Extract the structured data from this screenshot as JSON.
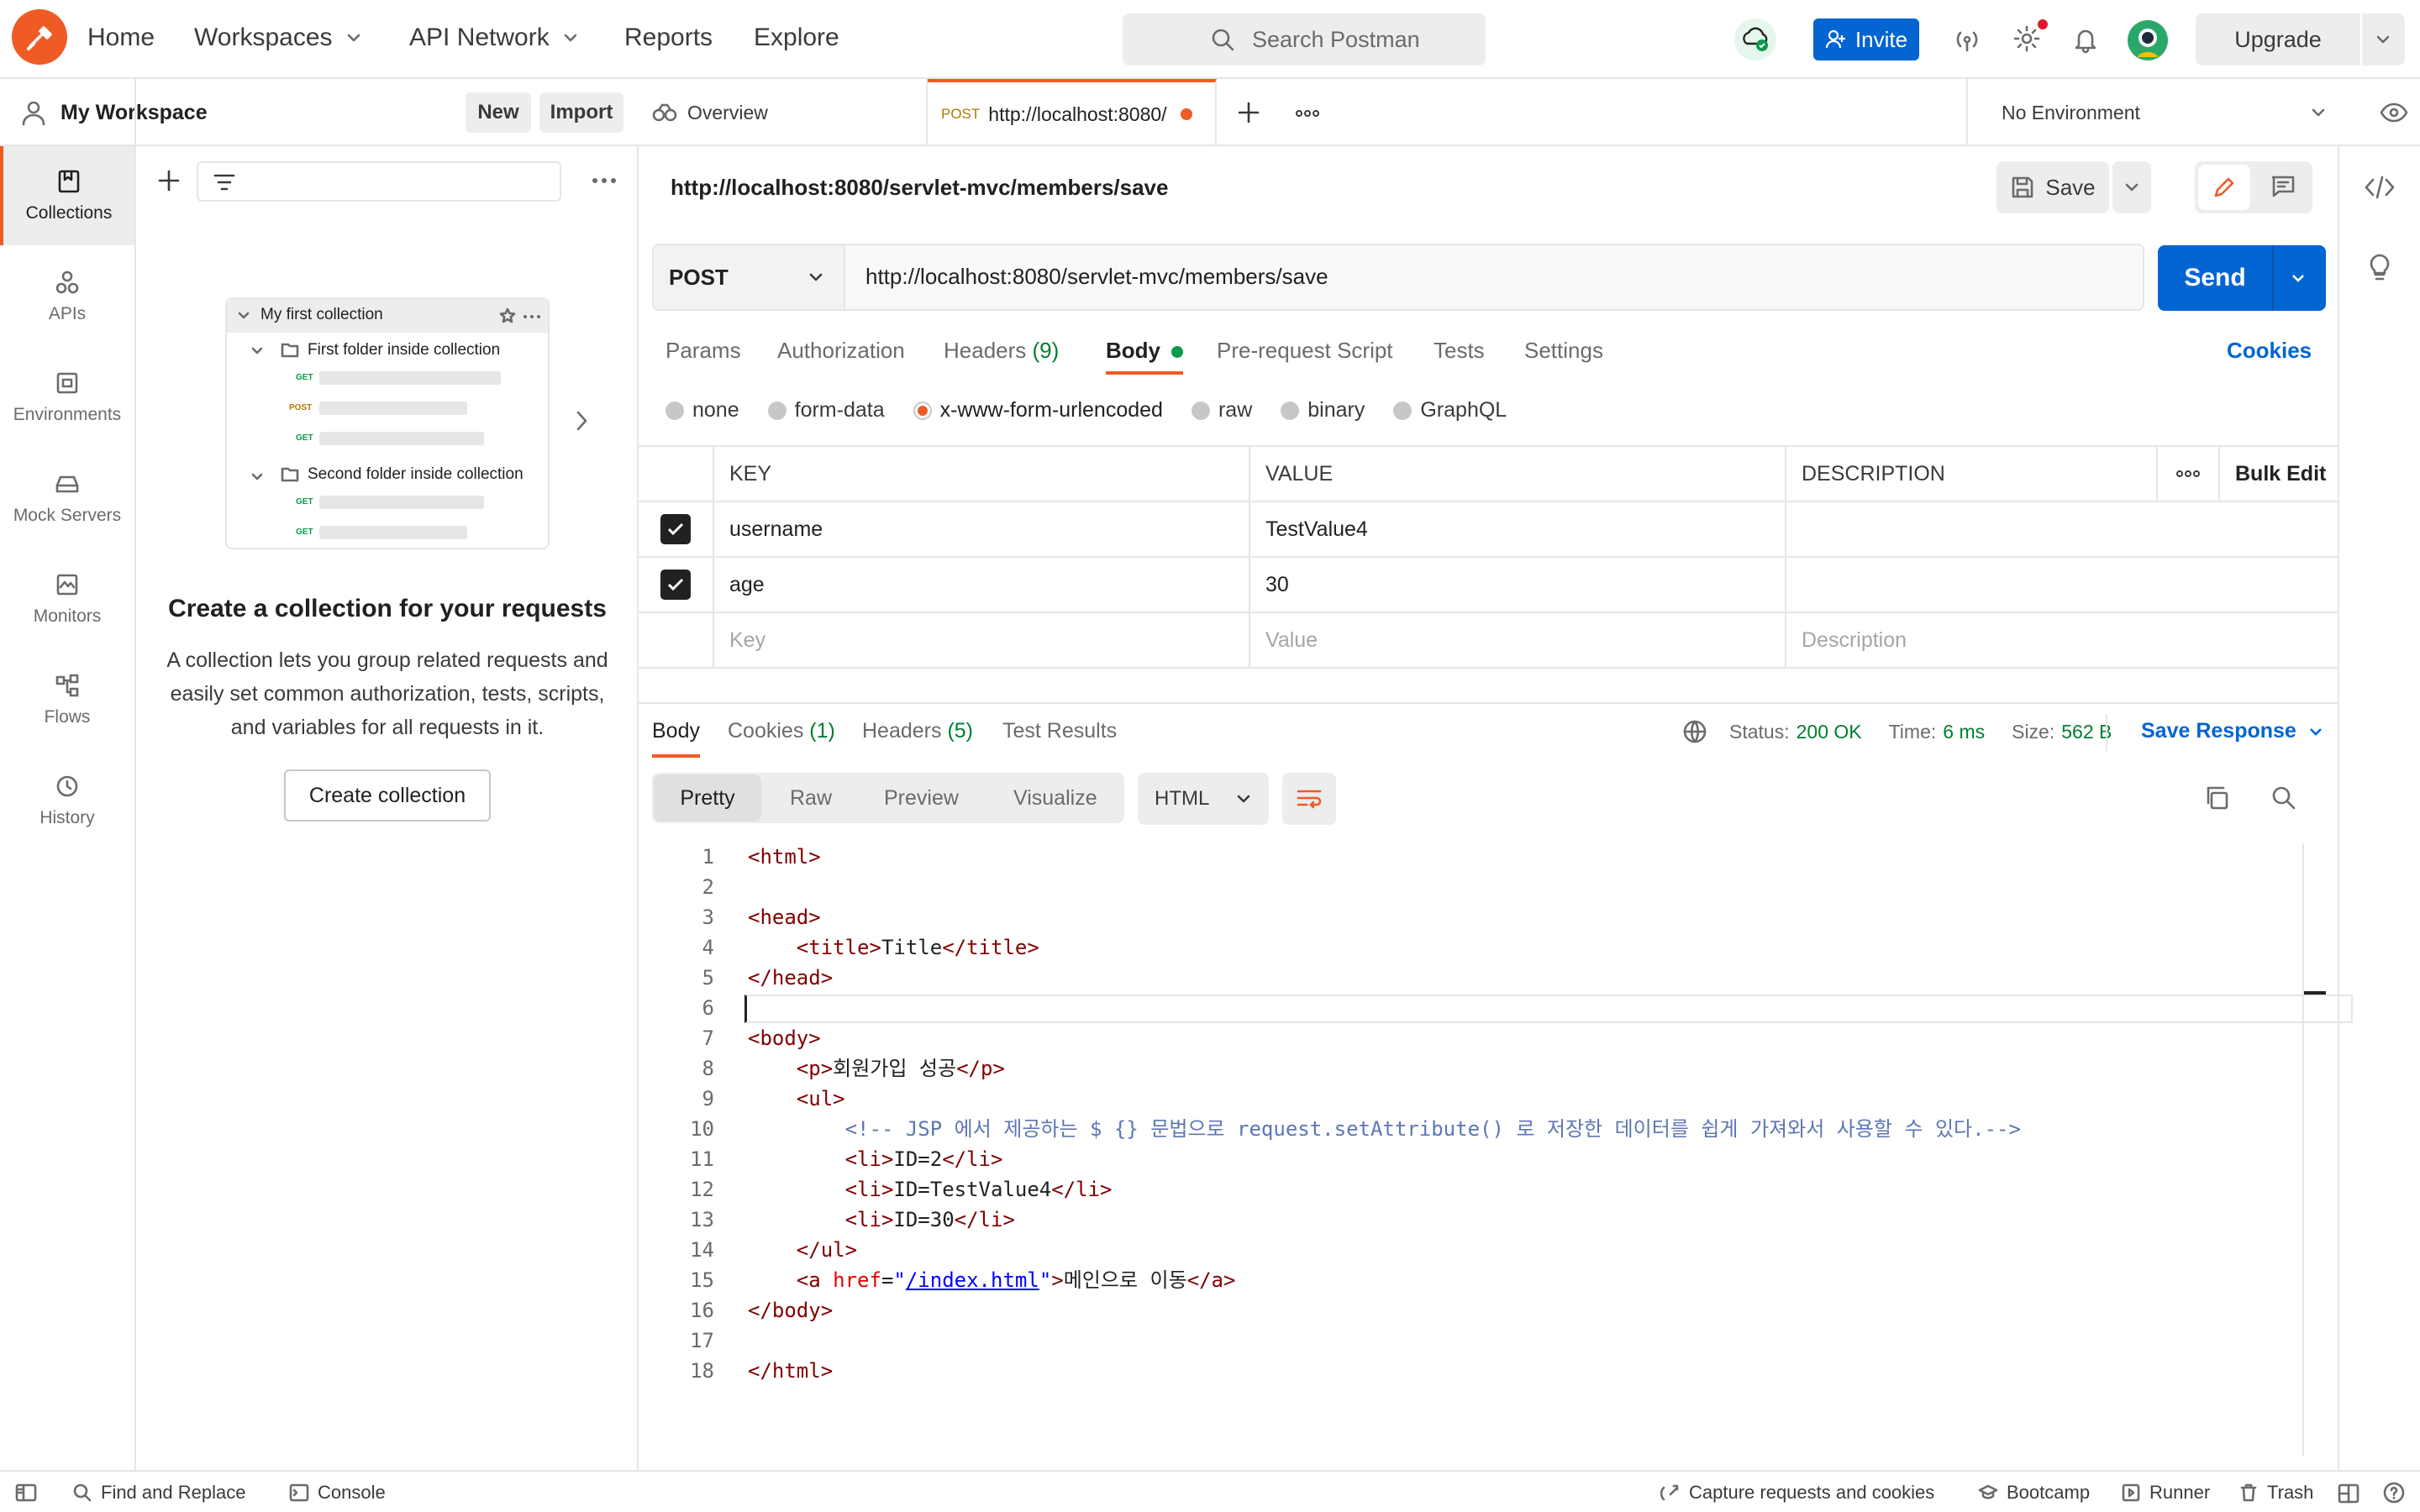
{
  "header": {
    "nav": [
      "Home",
      "Workspaces",
      "API Network",
      "Reports",
      "Explore"
    ],
    "search_placeholder": "Search Postman",
    "invite_label": "Invite",
    "upgrade_label": "Upgrade"
  },
  "workspace": {
    "name": "My Workspace",
    "new_label": "New",
    "import_label": "Import"
  },
  "leftnav": [
    {
      "label": "Collections",
      "icon": "collections-icon"
    },
    {
      "label": "APIs",
      "icon": "apis-icon"
    },
    {
      "label": "Environments",
      "icon": "environments-icon"
    },
    {
      "label": "Mock Servers",
      "icon": "mock-servers-icon"
    },
    {
      "label": "Monitors",
      "icon": "monitors-icon"
    },
    {
      "label": "Flows",
      "icon": "flows-icon"
    },
    {
      "label": "History",
      "icon": "history-icon"
    }
  ],
  "sidebar": {
    "illustration": {
      "collection": "My first collection",
      "folder1": "First folder inside collection",
      "folder2": "Second folder inside collection",
      "methods": [
        "GET",
        "POST",
        "GET",
        "GET",
        "GET"
      ]
    },
    "empty_title": "Create a collection for your requests",
    "empty_desc_lines": [
      "A collection lets you group related requests and",
      "easily set common authorization, tests, scripts,",
      "and variables for all requests in it."
    ],
    "create_button": "Create collection"
  },
  "tabs": {
    "overview": "Overview",
    "active_method": "POST",
    "active_title": "http://localhost:8080/",
    "environment": "No Environment"
  },
  "request": {
    "title": "http://localhost:8080/servlet-mvc/members/save",
    "save_label": "Save",
    "method": "POST",
    "url": "http://localhost:8080/servlet-mvc/members/save",
    "send_label": "Send",
    "subtabs": {
      "params": "Params",
      "authorization": "Authorization",
      "headers": "Headers",
      "headers_count": "(9)",
      "body": "Body",
      "prerequest": "Pre-request Script",
      "tests": "Tests",
      "settings": "Settings"
    },
    "cookies_label": "Cookies",
    "body_types": [
      "none",
      "form-data",
      "x-www-form-urlencoded",
      "raw",
      "binary",
      "GraphQL"
    ],
    "selected_body_type": "x-www-form-urlencoded",
    "table": {
      "headers": {
        "key": "KEY",
        "value": "VALUE",
        "description": "DESCRIPTION",
        "bulk_edit": "Bulk Edit"
      },
      "rows": [
        {
          "key": "username",
          "value": "TestValue4",
          "description": "",
          "checked": true
        },
        {
          "key": "age",
          "value": "30",
          "description": "",
          "checked": true
        }
      ],
      "placeholders": {
        "key": "Key",
        "value": "Value",
        "description": "Description"
      }
    }
  },
  "response": {
    "tabs": {
      "body": "Body",
      "cookies": "Cookies",
      "cookies_count": "(1)",
      "headers": "Headers",
      "headers_count": "(5)",
      "test_results": "Test Results"
    },
    "status_label": "Status:",
    "status": "200 OK",
    "time_label": "Time:",
    "time": "6 ms",
    "size_label": "Size:",
    "size": "562 B",
    "save_response": "Save Response",
    "view_modes": [
      "Pretty",
      "Raw",
      "Preview",
      "Visualize"
    ],
    "format": "HTML",
    "code_lines": [
      "<html>",
      "",
      "<head>",
      "    <title>Title</title>",
      "</head>",
      "",
      "<body>",
      "    <p>회원가입 성공</p>",
      "    <ul>",
      "        <!-- JSP 에서 제공하는 $ {} 문법으로 request.setAttribute() 로 저장한 데이터를 쉽게 가져와서 사용할 수 있다.-->",
      "        <li>ID=2</li>",
      "        <li>ID=TestValue4</li>",
      "        <li>ID=30</li>",
      "    </ul>",
      "    <a href=\"/index.html\">메인으로 이동</a>",
      "</body>",
      "",
      "</html>"
    ]
  },
  "statusbar": {
    "find_replace": "Find and Replace",
    "console": "Console",
    "capture": "Capture requests and cookies",
    "bootcamp": "Bootcamp",
    "runner": "Runner",
    "trash": "Trash"
  },
  "colors": {
    "accent": "#ef5b25",
    "primary": "#0265d2",
    "send": "#0265d2",
    "success": "#007f31"
  }
}
